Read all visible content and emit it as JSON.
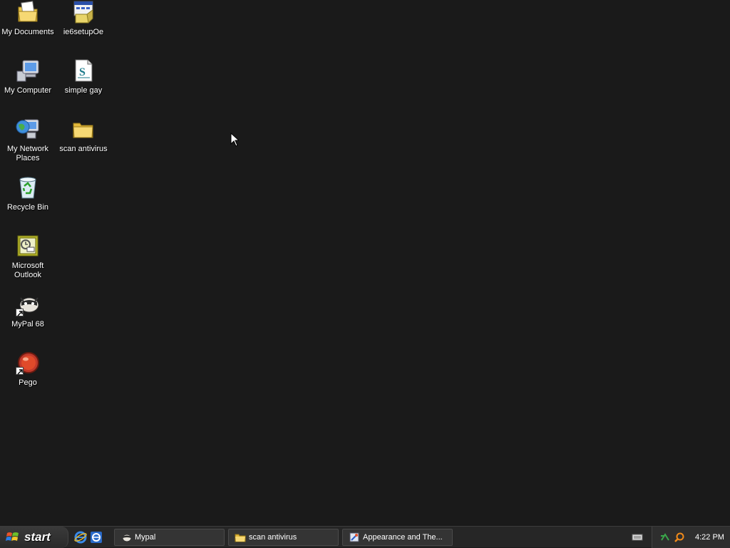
{
  "desktop": {
    "icons": [
      {
        "label": "My Documents"
      },
      {
        "label": "ie6setupOe"
      },
      {
        "label": "My Computer"
      },
      {
        "label": "simple gay"
      },
      {
        "label": "My Network Places"
      },
      {
        "label": "scan antivirus"
      },
      {
        "label": "Recycle Bin"
      },
      {
        "label": "Microsoft Outlook"
      },
      {
        "label": "MyPal 68"
      },
      {
        "label": "Pego"
      }
    ]
  },
  "taskbar": {
    "start_label": "start",
    "quick_launch": [
      "internet-explorer-icon",
      "ie-alt-icon"
    ],
    "tasks": [
      {
        "label": "Mypal",
        "icon": "mypal-icon"
      },
      {
        "label": "scan antivirus",
        "icon": "folder-icon"
      },
      {
        "label": "Appearance and The...",
        "icon": "control-panel-icon"
      }
    ],
    "clock": "4:22 PM"
  }
}
